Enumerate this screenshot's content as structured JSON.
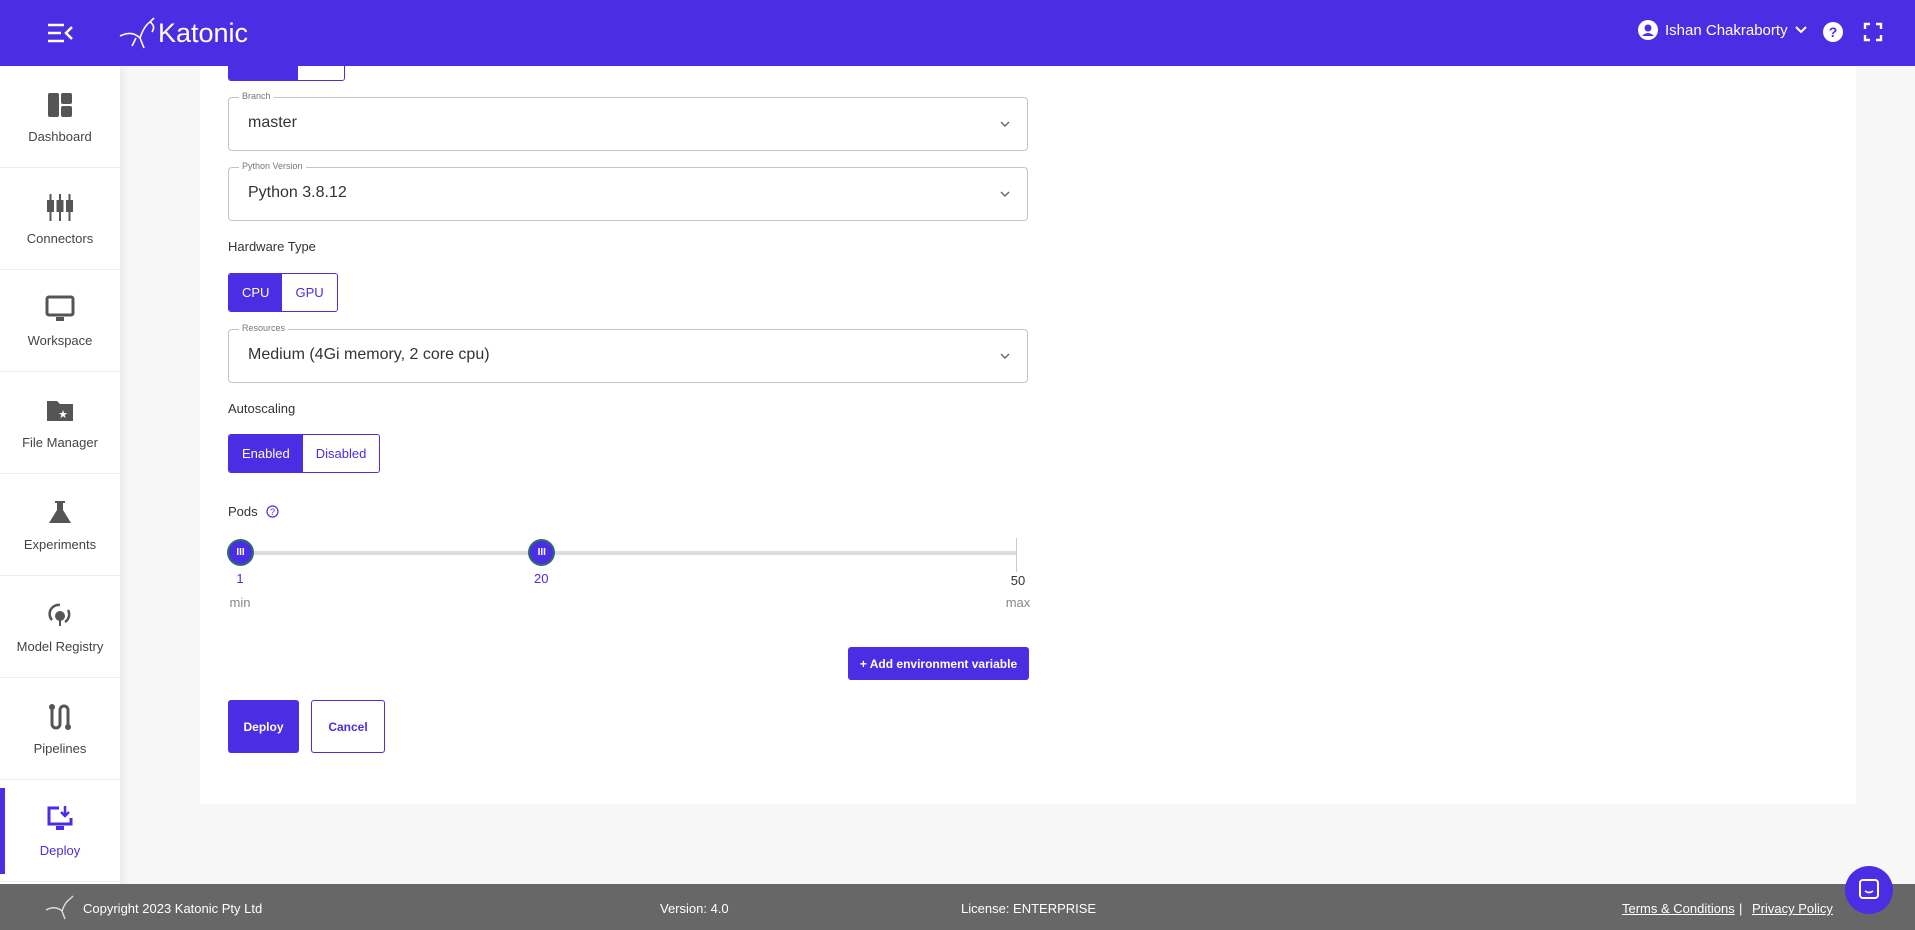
{
  "header": {
    "brand": "Katonic",
    "user_name": "Ishan Chakraborty"
  },
  "sidebar": {
    "items": [
      {
        "label": "Dashboard",
        "icon": "dashboard-icon"
      },
      {
        "label": "Connectors",
        "icon": "connectors-icon"
      },
      {
        "label": "Workspace",
        "icon": "monitor-icon"
      },
      {
        "label": "File Manager",
        "icon": "folder-star-icon"
      },
      {
        "label": "Experiments",
        "icon": "flask-icon"
      },
      {
        "label": "Model Registry",
        "icon": "model-registry-icon"
      },
      {
        "label": "Pipelines",
        "icon": "pipeline-icon"
      },
      {
        "label": "Deploy",
        "icon": "deploy-icon",
        "active": true
      }
    ]
  },
  "form": {
    "branch": {
      "label": "Branch",
      "value": "master"
    },
    "python": {
      "label": "Python Version",
      "value": "Python 3.8.12"
    },
    "hardware": {
      "label": "Hardware Type",
      "options": [
        "CPU",
        "GPU"
      ],
      "selected": "CPU"
    },
    "resources": {
      "label": "Resources",
      "value": "Medium (4Gi memory, 2 core cpu)"
    },
    "autoscaling": {
      "label": "Autoscaling",
      "options": [
        "Enabled",
        "Disabled"
      ],
      "selected": "Enabled"
    },
    "pods": {
      "label": "Pods",
      "min": 1,
      "max": 50,
      "min_value": "1",
      "max_value": "20",
      "max_limit": "50",
      "min_caption": "min",
      "max_caption": "max"
    },
    "add_env_label": "+ Add environment variable",
    "deploy_label": "Deploy",
    "cancel_label": "Cancel"
  },
  "footer": {
    "copyright": "Copyright 2023 Katonic Pty Ltd",
    "version": "Version: 4.0",
    "license": "License: ENTERPRISE",
    "terms": "Terms & Conditions",
    "separator": "|",
    "privacy": "Privacy Policy"
  },
  "colors": {
    "accent": "#4b2de3",
    "footer": "#676767"
  }
}
